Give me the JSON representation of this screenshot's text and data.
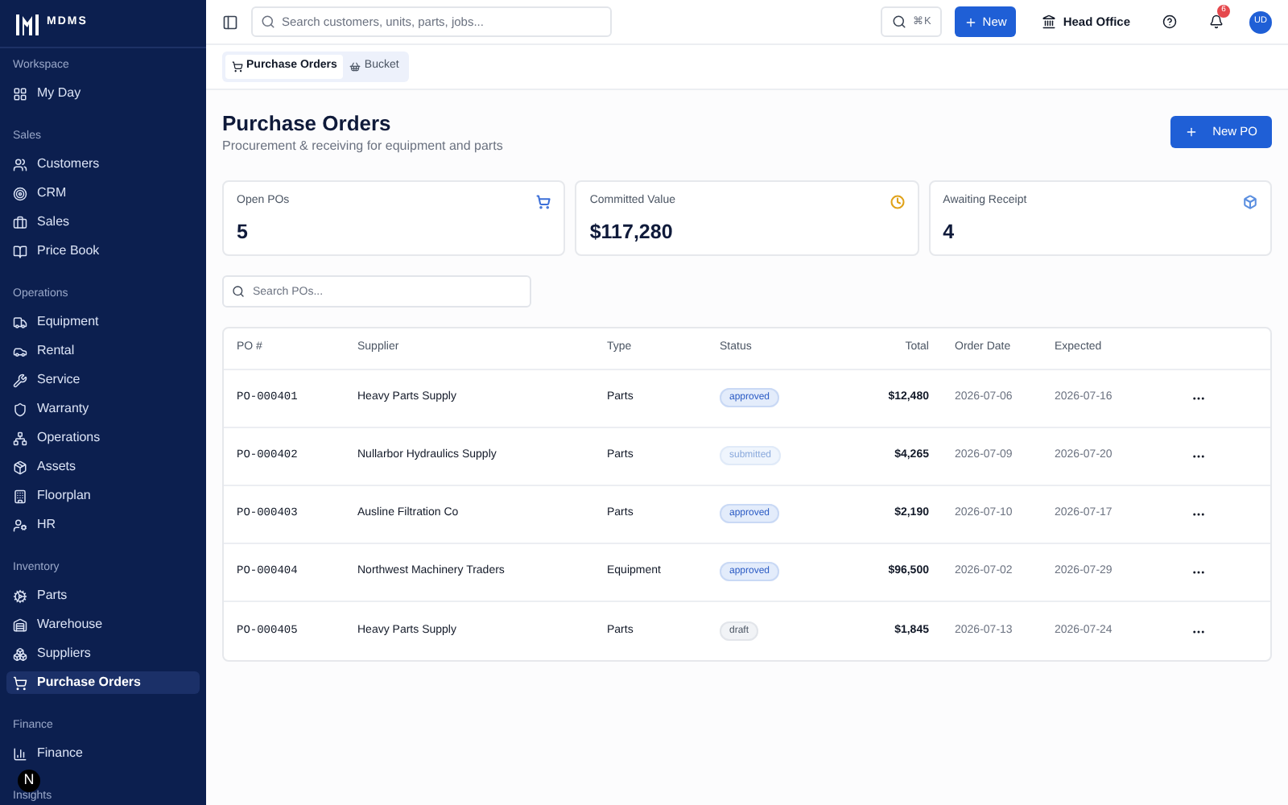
{
  "sidebar": {
    "logo": "MDMS",
    "sections": [
      {
        "label": "Workspace",
        "items": [
          {
            "label": "My Day",
            "selected": false
          }
        ]
      },
      {
        "label": "Sales",
        "items": [
          {
            "label": "Customers",
            "selected": false
          },
          {
            "label": "CRM",
            "selected": false
          },
          {
            "label": "Sales",
            "selected": false
          },
          {
            "label": "Price Book",
            "selected": false
          }
        ]
      },
      {
        "label": "Operations",
        "items": [
          {
            "label": "Equipment",
            "selected": false
          },
          {
            "label": "Rental",
            "selected": false
          },
          {
            "label": "Service",
            "selected": false
          },
          {
            "label": "Warranty",
            "selected": false
          },
          {
            "label": "Operations",
            "selected": false
          },
          {
            "label": "Assets",
            "selected": false
          },
          {
            "label": "Floorplan",
            "selected": false
          },
          {
            "label": "HR",
            "selected": false
          }
        ]
      },
      {
        "label": "Inventory",
        "items": [
          {
            "label": "Parts",
            "selected": false
          },
          {
            "label": "Warehouse",
            "selected": false
          },
          {
            "label": "Suppliers",
            "selected": false
          },
          {
            "label": "Purchase Orders",
            "selected": true
          }
        ]
      },
      {
        "label": "Finance",
        "items": [
          {
            "label": "Finance",
            "selected": false
          }
        ]
      },
      {
        "label": "Insights"
      }
    ],
    "dev_indicator": "N"
  },
  "topbar": {
    "search": {
      "placeholder": "Search customers, units, parts, jobs..."
    },
    "shortcut": "⌘K",
    "new_button": "New",
    "branch": "Head Office",
    "notifications": "6",
    "avatar": "UD"
  },
  "tabs": [
    {
      "label": "Purchase Orders",
      "selected": true
    },
    {
      "label": "Bucket",
      "selected": false
    }
  ],
  "page": {
    "title": "Purchase Orders",
    "subtitle": "Procurement & receiving for equipment and parts",
    "new_button": "New PO"
  },
  "stats": [
    {
      "label": "Open POs",
      "value": "5",
      "color": "#3b6fd8"
    },
    {
      "label": "Committed Value",
      "value": "$117,280",
      "color": "#e0a21a"
    },
    {
      "label": "Awaiting Receipt",
      "value": "4",
      "color": "#5b8fe0"
    }
  ],
  "table_search": {
    "placeholder": "Search POs..."
  },
  "table": {
    "columns": [
      "PO #",
      "Supplier",
      "Type",
      "Status",
      "Total",
      "Order Date",
      "Expected"
    ],
    "rows": [
      {
        "po": "PO-000401",
        "supplier": "Heavy Parts Supply",
        "type": "Parts",
        "status": "approved",
        "kind": "approved",
        "total": "$12,480",
        "order_date": "2026-07-06",
        "expected": "2026-07-16"
      },
      {
        "po": "PO-000402",
        "supplier": "Nullarbor Hydraulics Supply",
        "type": "Parts",
        "status": "submitted",
        "kind": "submitted",
        "total": "$4,265",
        "order_date": "2026-07-09",
        "expected": "2026-07-20"
      },
      {
        "po": "PO-000403",
        "supplier": "Ausline Filtration Co",
        "type": "Parts",
        "status": "approved",
        "kind": "approved",
        "total": "$2,190",
        "order_date": "2026-07-10",
        "expected": "2026-07-17"
      },
      {
        "po": "PO-000404",
        "supplier": "Northwest Machinery Traders",
        "type": "Equipment",
        "status": "approved",
        "kind": "approved",
        "total": "$96,500",
        "order_date": "2026-07-02",
        "expected": "2026-07-29"
      },
      {
        "po": "PO-000405",
        "supplier": "Heavy Parts Supply",
        "type": "Parts",
        "status": "draft",
        "kind": "draft",
        "total": "$1,845",
        "order_date": "2026-07-13",
        "expected": "2026-07-24"
      }
    ]
  }
}
